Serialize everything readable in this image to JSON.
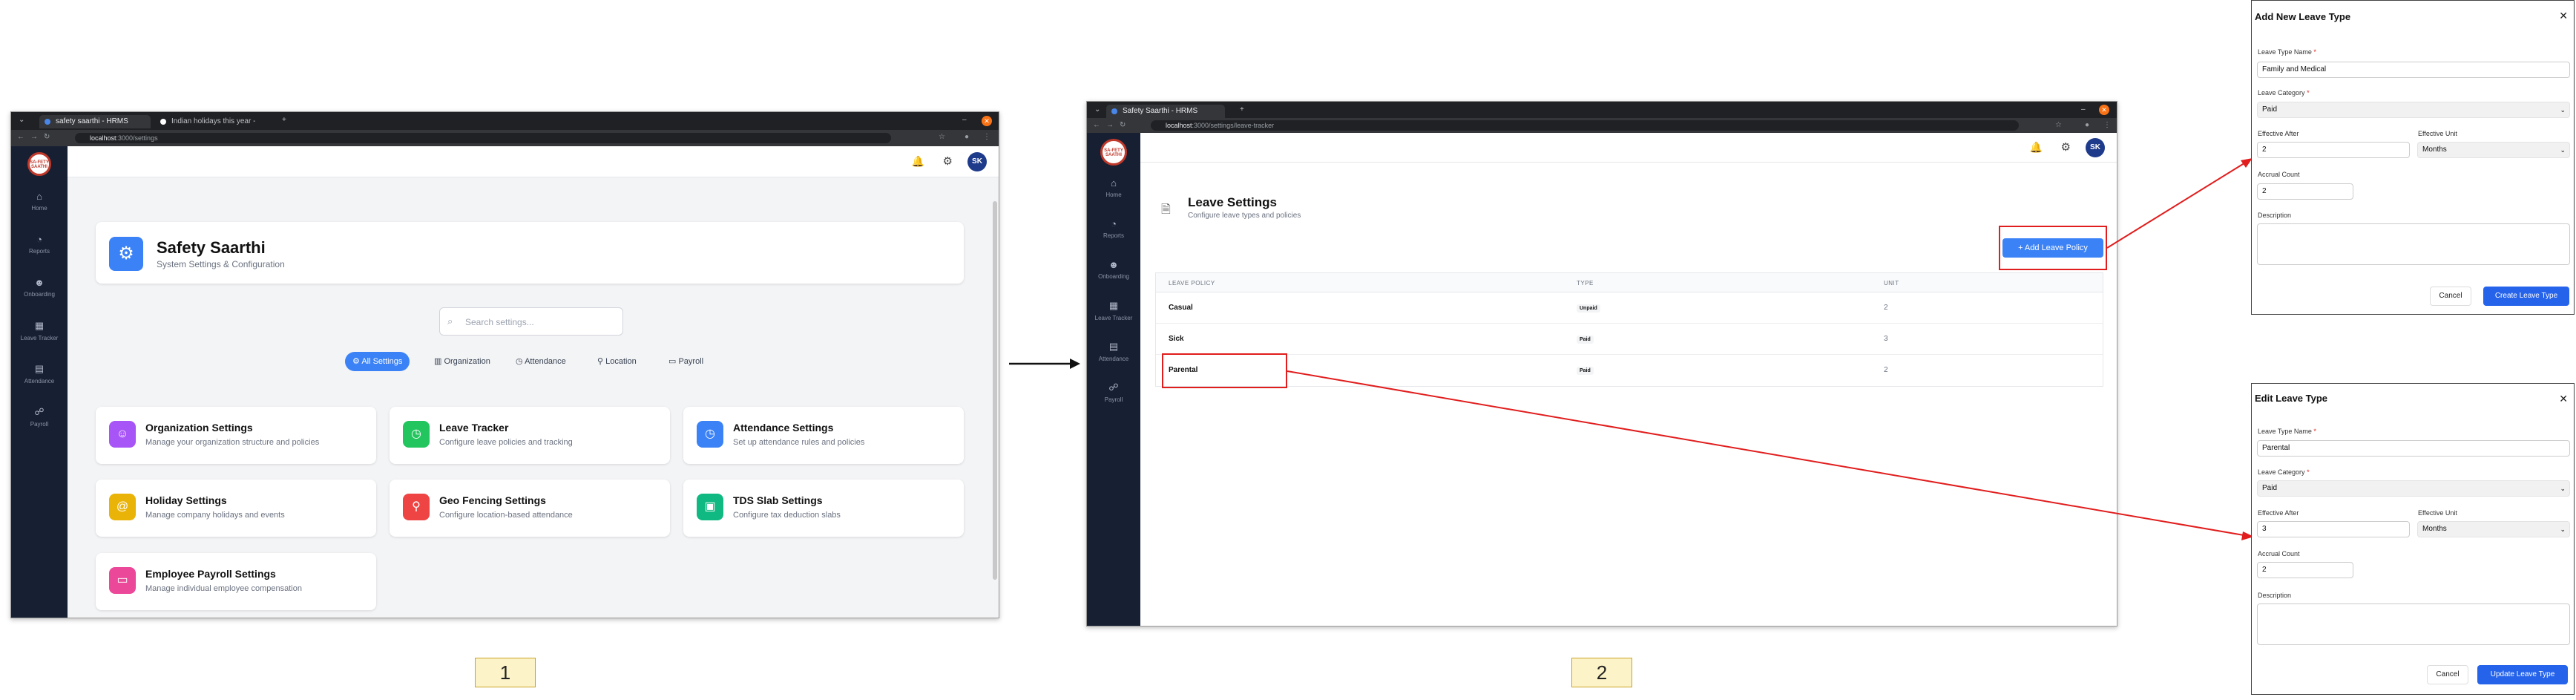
{
  "screen1": {
    "tabs": [
      {
        "title": "safety saarthi - HRMS"
      },
      {
        "title": "Indian holidays this year -"
      }
    ],
    "url": {
      "host": "localhost",
      "path": ":3000/settings"
    },
    "sidebar": [
      "Home",
      "Reports",
      "Onboarding",
      "Leave Tracker",
      "Attendance",
      "Payroll"
    ],
    "logo": "SA-FETY SAATHI",
    "avatar": "SK",
    "header": {
      "title": "Safety Saarthi",
      "subtitle": "System Settings & Configuration"
    },
    "search_placeholder": "Search settings...",
    "filters": [
      "All Settings",
      "Organization",
      "Attendance",
      "Location",
      "Payroll"
    ],
    "cards": [
      {
        "title": "Organization Settings",
        "desc": "Manage your organization structure and policies",
        "color": "#a855f7",
        "icon": "people-icon"
      },
      {
        "title": "Leave Tracker",
        "desc": "Configure leave policies and tracking",
        "color": "#22c55e",
        "icon": "clock-icon"
      },
      {
        "title": "Attendance Settings",
        "desc": "Set up attendance rules and policies",
        "color": "#3b82f6",
        "icon": "clock-icon"
      },
      {
        "title": "Holiday Settings",
        "desc": "Manage company holidays and events",
        "color": "#eab308",
        "icon": "at-icon"
      },
      {
        "title": "Geo Fencing Settings",
        "desc": "Configure location-based attendance",
        "color": "#ef4444",
        "icon": "location-icon"
      },
      {
        "title": "TDS Slab Settings",
        "desc": "Configure tax deduction slabs",
        "color": "#10b981",
        "icon": "receipt-icon"
      },
      {
        "title": "Employee Payroll Settings",
        "desc": "Manage individual employee compensation",
        "color": "#ec4899",
        "icon": "money-icon"
      }
    ]
  },
  "screen2": {
    "tabs": [
      {
        "title": "Safety Saarthi - HRMS"
      }
    ],
    "url": {
      "host": "localhost",
      "path": ":3000/settings/leave-tracker"
    },
    "sidebar": [
      "Home",
      "Reports",
      "Onboarding",
      "Leave Tracker",
      "Attendance",
      "Payroll"
    ],
    "logo": "SA-FETY SAATHI",
    "avatar": "SK",
    "title": "Leave Settings",
    "subtitle": "Configure leave types and policies",
    "add_button": "+ Add Leave Policy",
    "columns": [
      "LEAVE POLICY",
      "TYPE",
      "UNIT"
    ],
    "rows": [
      {
        "name": "Casual",
        "type": "Unpaid",
        "unit": "2"
      },
      {
        "name": "Sick",
        "type": "Paid",
        "unit": "3"
      },
      {
        "name": "Parental",
        "type": "Paid",
        "unit": "2"
      }
    ]
  },
  "dialog_add": {
    "title": "Add New Leave Type",
    "name_label": "Leave Type Name",
    "name_value": "Family and Medical",
    "category_label": "Leave Category",
    "category_value": "Paid",
    "after_label": "Effective After",
    "after_value": "2",
    "unit_label": "Effective Unit",
    "unit_value": "Months",
    "accrual_label": "Accrual Count",
    "accrual_value": "2",
    "desc_label": "Description",
    "cancel": "Cancel",
    "submit": "Create Leave Type"
  },
  "dialog_edit": {
    "title": "Edit Leave Type",
    "name_label": "Leave Type Name",
    "name_value": "Parental",
    "category_label": "Leave Category",
    "category_value": "Paid",
    "after_label": "Effective After",
    "after_value": "3",
    "unit_label": "Effective Unit",
    "unit_value": "Months",
    "accrual_label": "Accrual Count",
    "accrual_value": "2",
    "desc_label": "Description",
    "cancel": "Cancel",
    "submit": "Update Leave Type"
  },
  "step_labels": [
    "1",
    "2"
  ],
  "colors": {
    "accent": "#3b82f6",
    "annotation": "#e11d1d",
    "sidebar": "#172033"
  }
}
